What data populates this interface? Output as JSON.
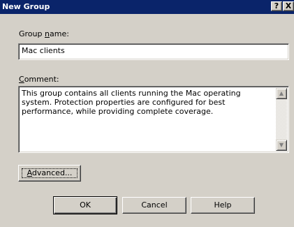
{
  "window": {
    "title": "New Group",
    "help_glyph": "?",
    "close_glyph": "X"
  },
  "group_name": {
    "label_pre": "Group ",
    "label_accel": "n",
    "label_post": "ame:",
    "value": "Mac clients"
  },
  "comment": {
    "label_pre": "",
    "label_accel": "C",
    "label_post": "omment:",
    "value": "This group contains all clients running the Mac operating\nsystem. Protection properties are configured for best\nperformance, while providing complete coverage."
  },
  "buttons": {
    "advanced_accel": "A",
    "advanced_post": "dvanced...",
    "ok": "OK",
    "cancel": "Cancel",
    "help": "Help"
  },
  "icons": {
    "scroll_up": "▲",
    "scroll_down": "▼"
  }
}
